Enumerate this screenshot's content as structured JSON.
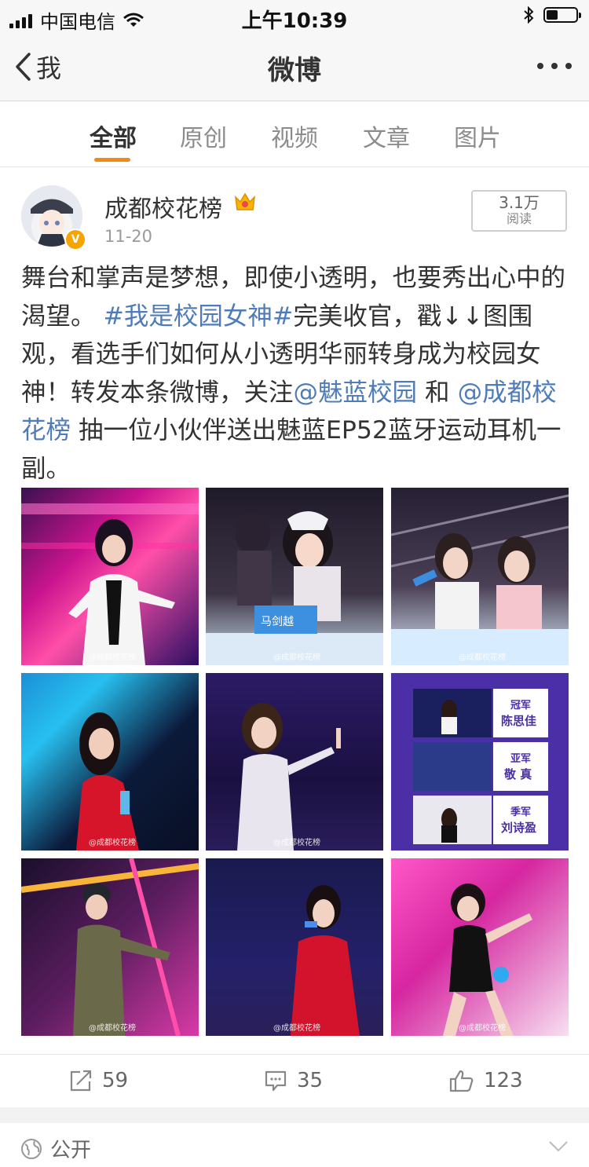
{
  "status_bar": {
    "carrier": "中国电信",
    "time": "上午10:39"
  },
  "nav": {
    "back_label": "我",
    "title": "微博"
  },
  "tabs": [
    {
      "label": "全部",
      "active": true
    },
    {
      "label": "原创",
      "active": false
    },
    {
      "label": "视频",
      "active": false
    },
    {
      "label": "文章",
      "active": false
    },
    {
      "label": "图片",
      "active": false
    }
  ],
  "post": {
    "author": "成都校花榜",
    "time": "11-20",
    "read_count": "3.1万",
    "read_label": "阅读",
    "text_1": "舞台和掌声是梦想，即使小透明，也要秀出心中的渴望。",
    "hashtag": "#我是校园女神#",
    "text_2": "完美收官，戳↓↓图围观，看选手们如何从小透明华丽转身成为校园女神！转发本条微博，关注",
    "mention_1": "@魅蓝校园",
    "text_3": " 和 ",
    "mention_2": "@成都校花榜",
    "text_4": " 抽一位小伙伴送出魅蓝EP52蓝牙运动耳机一副。",
    "watermark": "@成都校花榜",
    "photo_labels": {
      "p2_name": "马剑越",
      "p6_gold": "冠军",
      "p6_gold_name": "陈思佳",
      "p6_silver": "亚军",
      "p6_silver_name": "敬 真",
      "p6_bronze": "季军",
      "p6_bronze_name": "刘诗盈"
    }
  },
  "actions": {
    "repost": "59",
    "comment": "35",
    "like": "123"
  },
  "footer": {
    "privacy": "公开"
  }
}
